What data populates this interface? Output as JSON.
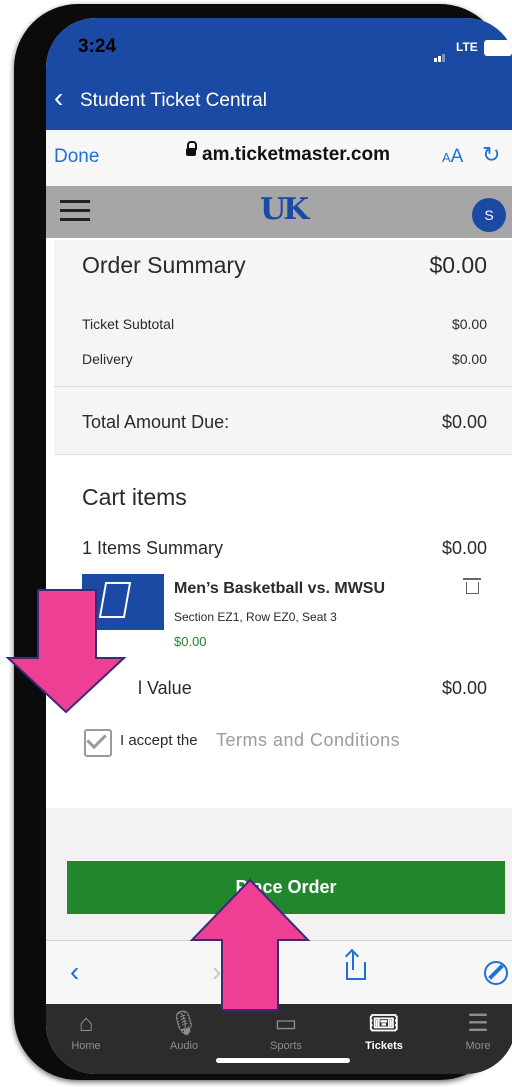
{
  "status_bar": {
    "time": "3:24",
    "network": "LTE"
  },
  "app_header": {
    "back_label": "Student Ticket Central"
  },
  "browser": {
    "done_label": "Done",
    "url": "am.ticketmaster.com",
    "text_size_label": "AA"
  },
  "site_header": {
    "avatar_initial": "S"
  },
  "order_summary": {
    "title": "Order Summary",
    "total": "$0.00",
    "rows": [
      {
        "label": "Ticket Subtotal",
        "value": "$0.00"
      },
      {
        "label": "Delivery",
        "value": "$0.00"
      }
    ],
    "amount_due_label": "Total Amount Due:",
    "amount_due_value": "$0.00"
  },
  "cart": {
    "title": "Cart items",
    "items_summary_label": "1 Items Summary",
    "items_summary_value": "$0.00",
    "item": {
      "name": "Men’s Basketball vs. MWSU",
      "details": "Section EZ1, Row EZ0, Seat 3",
      "price": "$0.00"
    },
    "total_value_label": "l Value",
    "total_value": "$0.00"
  },
  "terms": {
    "prefix": "I accept the",
    "link": "Terms and Conditions",
    "checked": true
  },
  "place_order_label": "Place Order",
  "tabbar": {
    "tabs": [
      {
        "label": "Home",
        "icon": "home-icon",
        "active": false
      },
      {
        "label": "Audio",
        "icon": "microphone-icon",
        "active": false
      },
      {
        "label": "Sports",
        "icon": "sports-icon",
        "active": false
      },
      {
        "label": "Tickets",
        "icon": "ticket-icon",
        "active": true
      },
      {
        "label": "More",
        "icon": "menu-icon",
        "active": false
      }
    ]
  },
  "colors": {
    "brand_blue": "#1b4aa4",
    "place_order_green": "#22862c",
    "price_green": "#22862c",
    "annotation_pink": "#ee3f95"
  }
}
